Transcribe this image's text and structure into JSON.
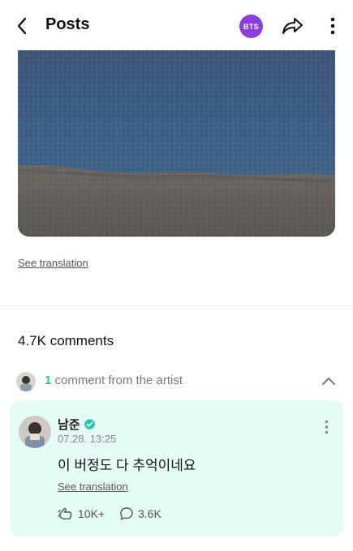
{
  "header": {
    "title": "Posts",
    "badge_label": "BTS",
    "back_icon": "back-arrow-icon",
    "share_icon": "share-icon",
    "more_icon": "more-vertical-icon",
    "badge_color": "#8a3de0"
  },
  "post": {
    "see_translation": "See translation"
  },
  "comments": {
    "count_label": "4.7K comments",
    "artist_row": {
      "count": "1",
      "text": " comment from the artist",
      "accent_color": "#23c4b1"
    },
    "artist_comment": {
      "author": "남준",
      "timestamp": "07.28. 13:25",
      "body": "이 버정도 다 추억이네요",
      "see_translation": "See translation",
      "likes": "10K+",
      "replies": "3.6K",
      "card_color": "#e5fbf6"
    }
  }
}
